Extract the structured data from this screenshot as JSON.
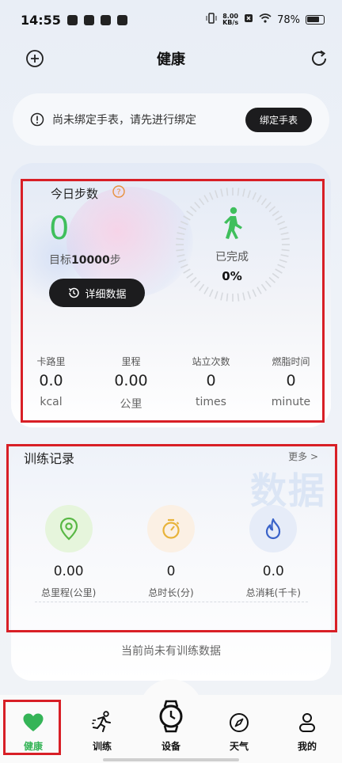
{
  "status_bar": {
    "time": "14:55",
    "speed_value": "8.00",
    "speed_unit": "KB/s",
    "battery": "78%"
  },
  "header": {
    "title": "健康",
    "add_icon": "plus-circle-icon",
    "refresh_icon": "refresh-icon"
  },
  "bind_notice": {
    "text": "尚未绑定手表，请先进行绑定",
    "button": "绑定手表",
    "icon": "info-icon"
  },
  "steps": {
    "title": "今日步数",
    "value": "0",
    "goal_prefix": "目标",
    "goal_value": "10000",
    "goal_suffix": "步",
    "detail_button": "详细数据",
    "completed_label": "已完成",
    "completed_percent": "0%",
    "accent": "#3fbf5c"
  },
  "stats": [
    {
      "title": "卡路里",
      "value": "0.0",
      "unit": "kcal"
    },
    {
      "title": "里程",
      "value": "0.00",
      "unit": "公里"
    },
    {
      "title": "站立次数",
      "value": "0",
      "unit": "times"
    },
    {
      "title": "燃脂时间",
      "value": "0",
      "unit": "minute"
    }
  ],
  "training": {
    "title": "训练记录",
    "more": "更多 >",
    "watermark": "数据",
    "items": [
      {
        "value": "0.00",
        "label": "总里程(公里)",
        "icon": "location-pin-icon"
      },
      {
        "value": "0",
        "label": "总时长(分)",
        "icon": "stopwatch-icon"
      },
      {
        "value": "0.0",
        "label": "总消耗(千卡)",
        "icon": "flame-icon"
      }
    ],
    "empty_note": "当前尚未有训练数据"
  },
  "tabs": [
    {
      "label": "健康",
      "icon": "heart-icon",
      "active": true
    },
    {
      "label": "训练",
      "icon": "runner-icon",
      "active": false
    },
    {
      "label": "设备",
      "icon": "watch-icon",
      "active": false
    },
    {
      "label": "天气",
      "icon": "compass-icon",
      "active": false
    },
    {
      "label": "我的",
      "icon": "person-icon",
      "active": false
    }
  ],
  "colors": {
    "active_tab": "#35b457",
    "highlight": "#d81f26"
  }
}
